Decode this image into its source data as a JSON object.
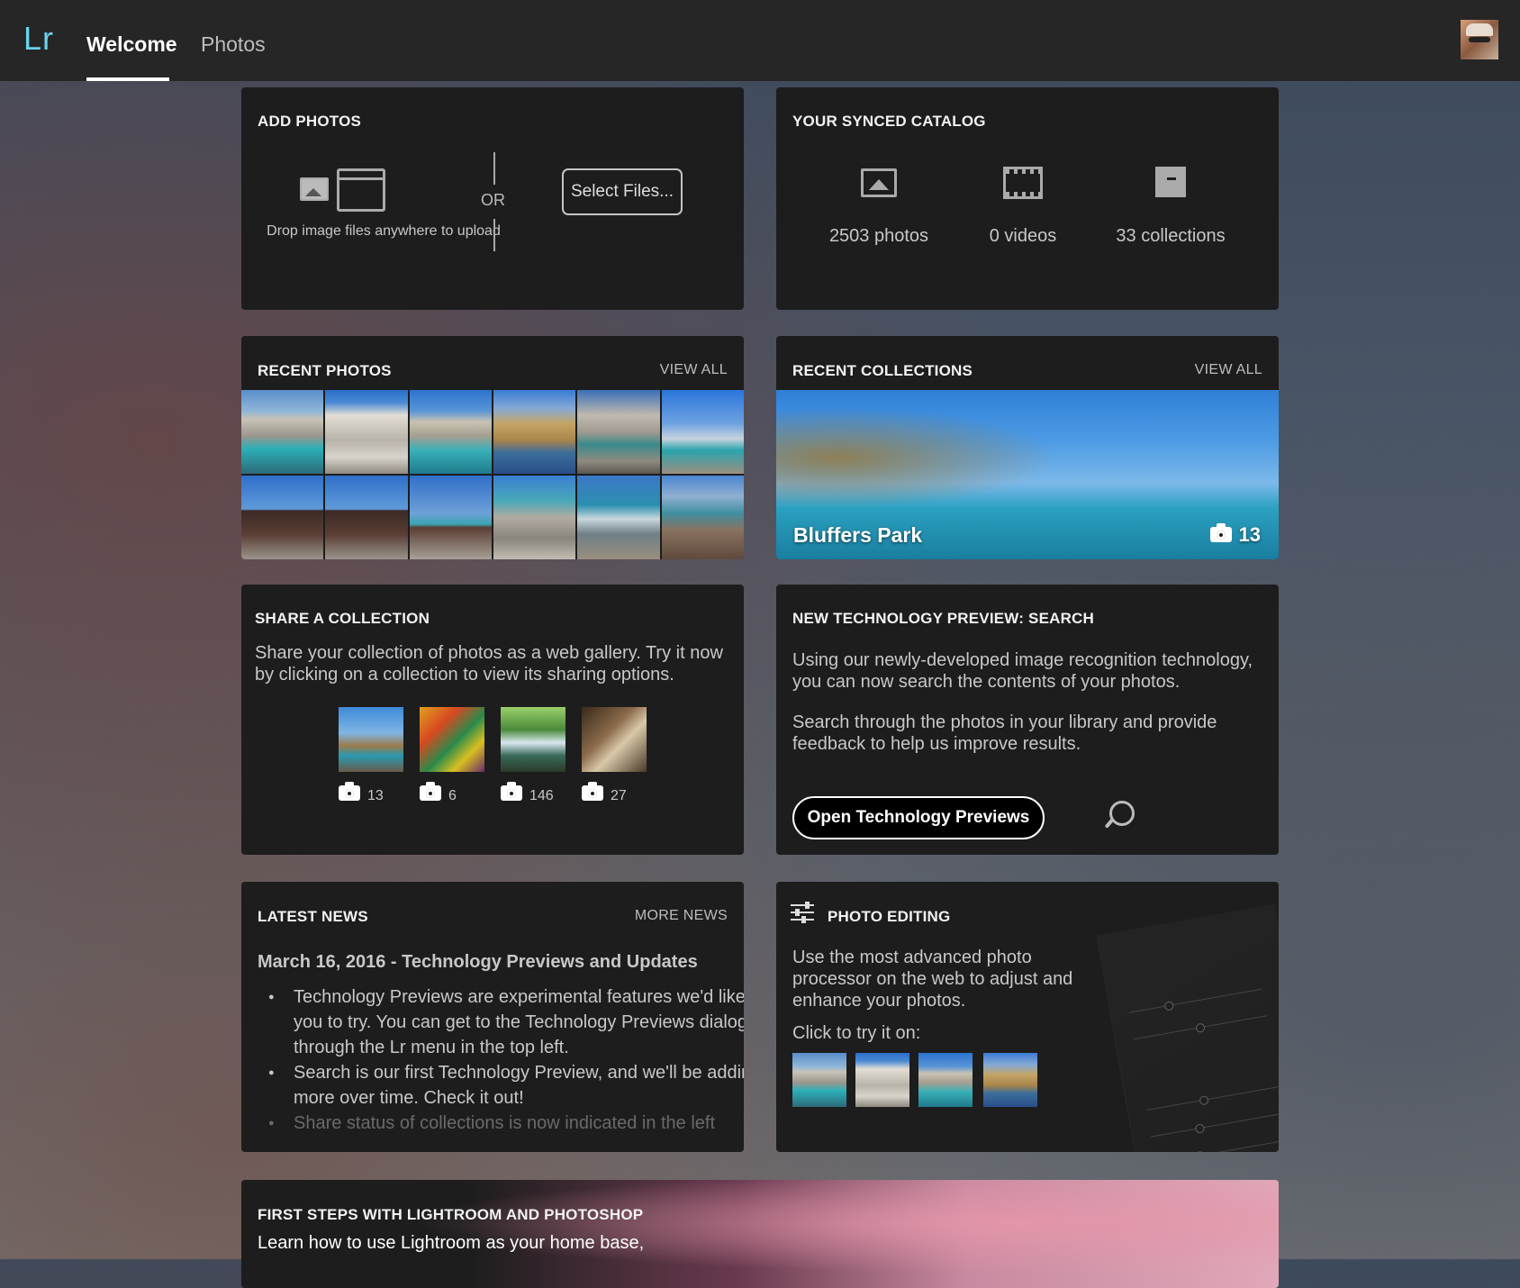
{
  "app": {
    "logo": "Lr"
  },
  "nav": {
    "tabs": [
      {
        "label": "Welcome",
        "active": true
      },
      {
        "label": "Photos",
        "active": false
      }
    ]
  },
  "add_photos": {
    "title": "ADD PHOTOS",
    "drop_text": "Drop image files anywhere to upload",
    "or": "OR",
    "select_button": "Select Files..."
  },
  "synced_catalog": {
    "title": "YOUR SYNCED CATALOG",
    "stats": [
      {
        "label": "2503 photos",
        "icon": "photo-icon"
      },
      {
        "label": "0 videos",
        "icon": "film-icon"
      },
      {
        "label": "33 collections",
        "icon": "archive-icon"
      }
    ]
  },
  "recent_photos": {
    "title": "RECENT PHOTOS",
    "view_all": "VIEW ALL",
    "thumbs": [
      "t-cliff1",
      "t-cliff2",
      "t-cliff3",
      "t-reeds",
      "t-shore",
      "t-tree",
      "t-inuk1",
      "t-inuk1",
      "t-inuk3",
      "t-rocks",
      "t-waves",
      "t-beach"
    ]
  },
  "recent_collections": {
    "title": "RECENT COLLECTIONS",
    "view_all": "VIEW ALL",
    "featured": {
      "name": "Bluffers Park",
      "count": "13"
    }
  },
  "share_collection": {
    "title": "SHARE A COLLECTION",
    "description": "Share your collection of photos as a web gallery. Try it now by clicking on a collection to view its sharing options.",
    "collections": [
      {
        "count": "13"
      },
      {
        "count": "6"
      },
      {
        "count": "146"
      },
      {
        "count": "27"
      }
    ]
  },
  "tech_preview": {
    "title": "NEW TECHNOLOGY PREVIEW: SEARCH",
    "paragraph1": "Using our newly-developed image recognition technology, you can now search the contents of your photos.",
    "paragraph2": "Search through the photos in your library and provide feedback to help us improve results.",
    "button": "Open Technology Previews"
  },
  "latest_news": {
    "title": "LATEST NEWS",
    "more": "MORE NEWS",
    "headline": "March 16, 2016 - Technology Previews and Updates",
    "items": [
      "Technology Previews are experimental features we'd like you to try. You can get to the Technology Previews dialog through the Lr menu in the top left.",
      "Search is our first Technology Preview, and we'll be adding more over time. Check it out!",
      "Share status of collections is now indicated in the left"
    ]
  },
  "photo_editing": {
    "title": "PHOTO EDITING",
    "description": "Use the most advanced photo processor on the web to adjust and enhance your photos.",
    "prompt": "Click to try it on:"
  },
  "first_steps": {
    "title": "FIRST STEPS WITH LIGHTROOM AND PHOTOSHOP",
    "description": "Learn how to use Lightroom as your home base,"
  }
}
